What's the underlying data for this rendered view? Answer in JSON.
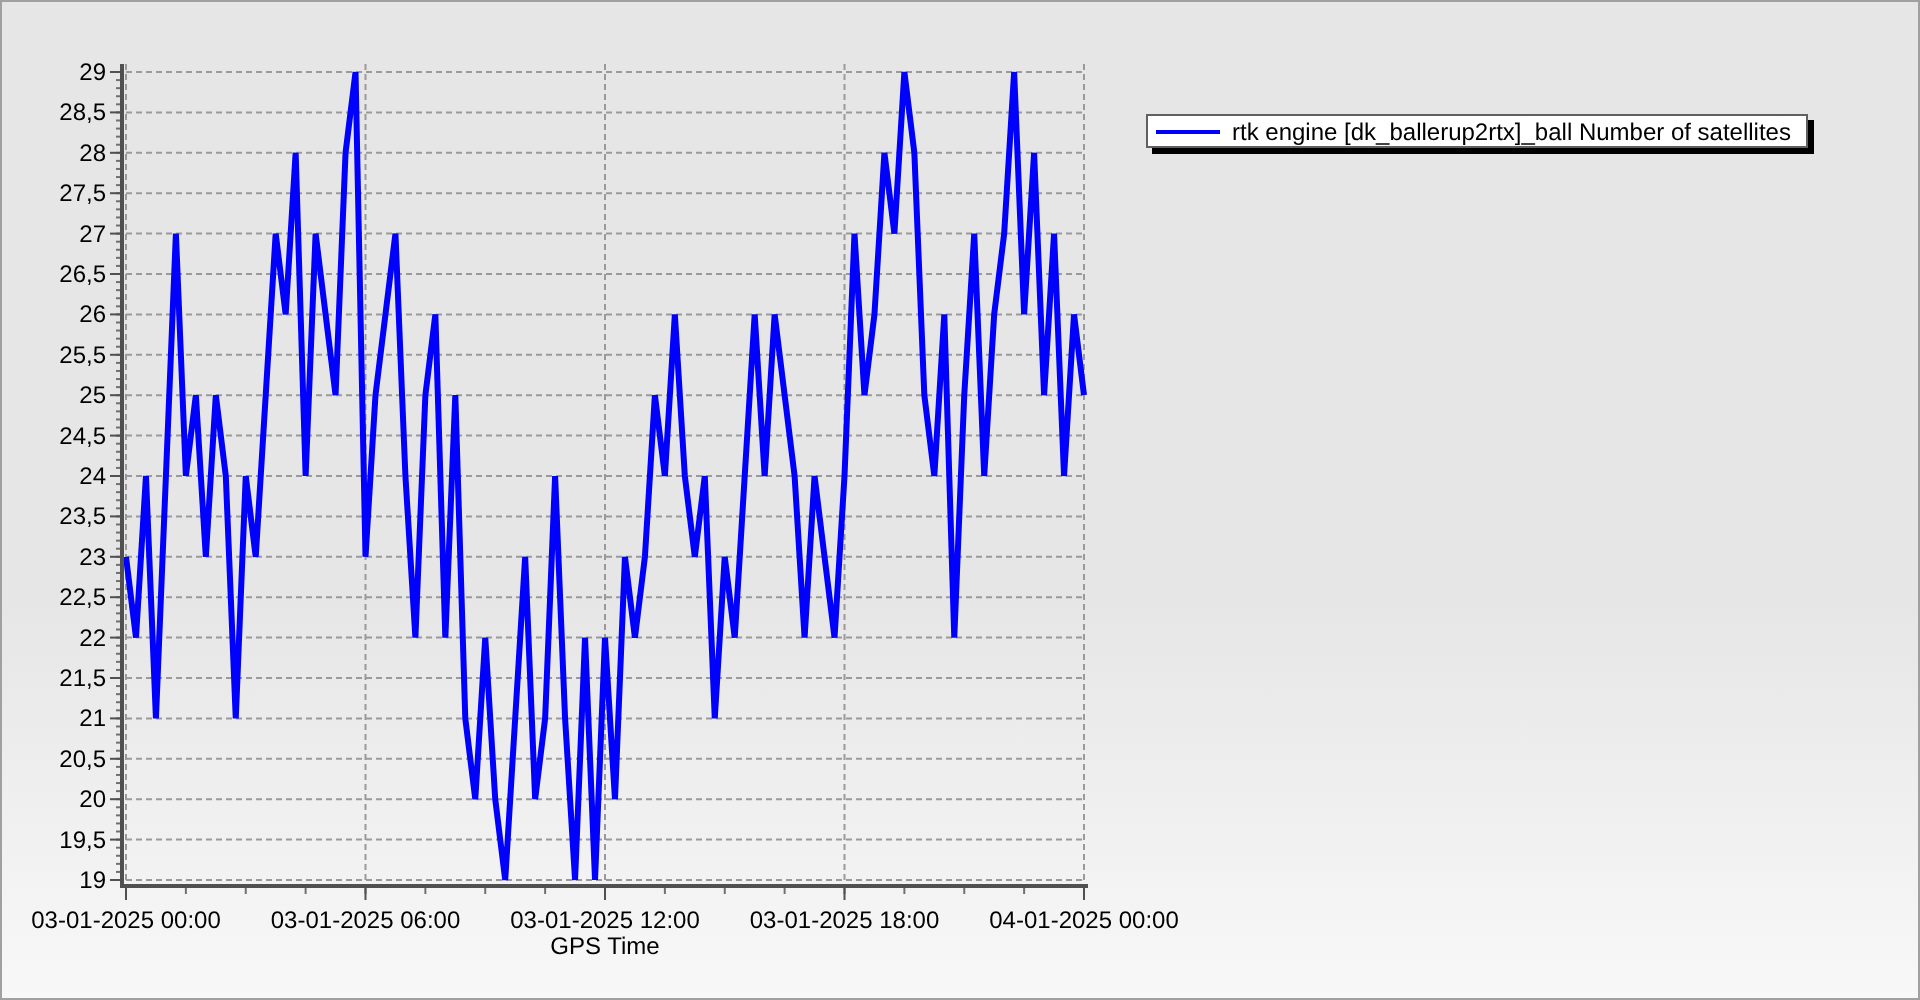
{
  "chart": {
    "chart_data": {
      "type": "line",
      "grid": true,
      "xlabel": "GPS Time",
      "ylim": [
        19,
        29
      ],
      "categories": [
        "03-01-2025 00:00",
        null,
        null,
        null,
        null,
        null,
        null,
        null,
        null,
        null,
        null,
        null,
        null,
        null,
        null,
        null,
        null,
        null,
        null,
        null,
        null,
        null,
        null,
        null,
        "03-01-2025 06:00",
        null,
        null,
        null,
        null,
        null,
        null,
        null,
        null,
        null,
        null,
        null,
        null,
        null,
        null,
        null,
        null,
        null,
        null,
        null,
        null,
        null,
        null,
        null,
        "03-01-2025 12:00",
        null,
        null,
        null,
        null,
        null,
        null,
        null,
        null,
        null,
        null,
        null,
        null,
        null,
        null,
        null,
        null,
        null,
        null,
        null,
        null,
        null,
        null,
        null,
        "03-01-2025 18:00",
        null,
        null,
        null,
        null,
        null,
        null,
        null,
        null,
        null,
        null,
        null,
        null,
        null,
        null,
        null,
        null,
        null,
        null,
        null,
        null,
        null,
        null,
        null,
        "04-01-2025 00:00"
      ],
      "yticks": [
        {
          "value": 19,
          "label": "19"
        },
        {
          "value": 19.5,
          "label": "19,5"
        },
        {
          "value": 20,
          "label": "20"
        },
        {
          "value": 20.5,
          "label": "20,5"
        },
        {
          "value": 21,
          "label": "21"
        },
        {
          "value": 21.5,
          "label": "21,5"
        },
        {
          "value": 22,
          "label": "22"
        },
        {
          "value": 22.5,
          "label": "22,5"
        },
        {
          "value": 23,
          "label": "23"
        },
        {
          "value": 23.5,
          "label": "23,5"
        },
        {
          "value": 24,
          "label": "24"
        },
        {
          "value": 24.5,
          "label": "24,5"
        },
        {
          "value": 25,
          "label": "25"
        },
        {
          "value": 25.5,
          "label": "25,5"
        },
        {
          "value": 26,
          "label": "26"
        },
        {
          "value": 26.5,
          "label": "26,5"
        },
        {
          "value": 27,
          "label": "27"
        },
        {
          "value": 27.5,
          "label": "27,5"
        },
        {
          "value": 28,
          "label": "28"
        },
        {
          "value": 28.5,
          "label": "28,5"
        },
        {
          "value": 29,
          "label": "29"
        }
      ],
      "series": [
        {
          "name": "rtk engine [dk_ballerup2rtx]_ball Number of satellites",
          "color": "#0000ff",
          "values": [
            23,
            22,
            24,
            21,
            24,
            27,
            24,
            25,
            23,
            25,
            24,
            21,
            24,
            23,
            25,
            27,
            26,
            28,
            24,
            27,
            26,
            25,
            28,
            29,
            23,
            25,
            26,
            27,
            24,
            22,
            25,
            26,
            22,
            25,
            21,
            20,
            22,
            20,
            19,
            21,
            23,
            20,
            21,
            24,
            21,
            19,
            22,
            19,
            22,
            20,
            23,
            22,
            23,
            25,
            24,
            26,
            24,
            23,
            24,
            21,
            23,
            22,
            24,
            26,
            24,
            26,
            25,
            24,
            22,
            24,
            23,
            22,
            24,
            27,
            25,
            26,
            28,
            27,
            29,
            28,
            25,
            24,
            26,
            22,
            25,
            27,
            24,
            26,
            27,
            29,
            26,
            28,
            25,
            27,
            24,
            26,
            25
          ]
        }
      ]
    }
  }
}
